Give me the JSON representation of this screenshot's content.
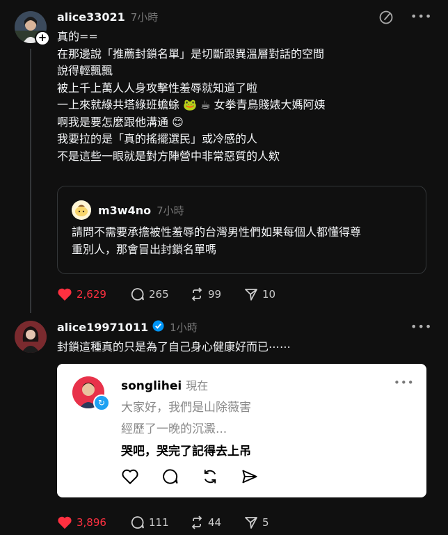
{
  "post1": {
    "username": "alice33021",
    "time": "7小時",
    "lines": [
      "真的==",
      "在那邊說「推薦封鎖名單」是切斷跟異溫層對話的空間",
      "說得輕飄飄",
      "被上千上萬人人身攻擊性羞辱就知道了啦",
      "一上來就綠共塔綠班蟾蜍 🐸 ☕ 女拳青鳥賤婊大媽阿姨",
      "啊我是要怎麼跟他溝通 😊",
      "我要拉的是「真的搖擺選民」或冷感的人",
      "不是這些一眼就是對方陣營中非常惡質的人欸"
    ],
    "quote": {
      "username": "m3w4no",
      "time": "7小時",
      "lines": [
        "請問不需要承擔被性羞辱的台灣男性們如果每個人都懂得尊",
        "重別人，那會冒出封鎖名單嗎"
      ]
    },
    "actions": {
      "likes": "2,629",
      "comments": "265",
      "reposts": "99",
      "shares": "10"
    }
  },
  "post2": {
    "username": "alice19971011",
    "time": "1小時",
    "text": "封鎖這種真的只是為了自己身心健康好而已⋯⋯",
    "embed": {
      "username": "songlihei",
      "time": "現在",
      "line1": "大家好，我們是山除薇害",
      "line2": "經歷了一晚的沉澱...",
      "line3": "哭吧，哭完了記得去上吊"
    },
    "actions": {
      "likes": "3,896",
      "comments": "111",
      "reposts": "44",
      "shares": "5"
    }
  },
  "colors": {
    "like": "#ff3040",
    "background": "#101010",
    "verified": "#0095f6"
  },
  "icons": [
    "heart-icon",
    "comment-icon",
    "repost-icon",
    "share-icon",
    "more-icon",
    "draft-icon",
    "verified-icon"
  ]
}
